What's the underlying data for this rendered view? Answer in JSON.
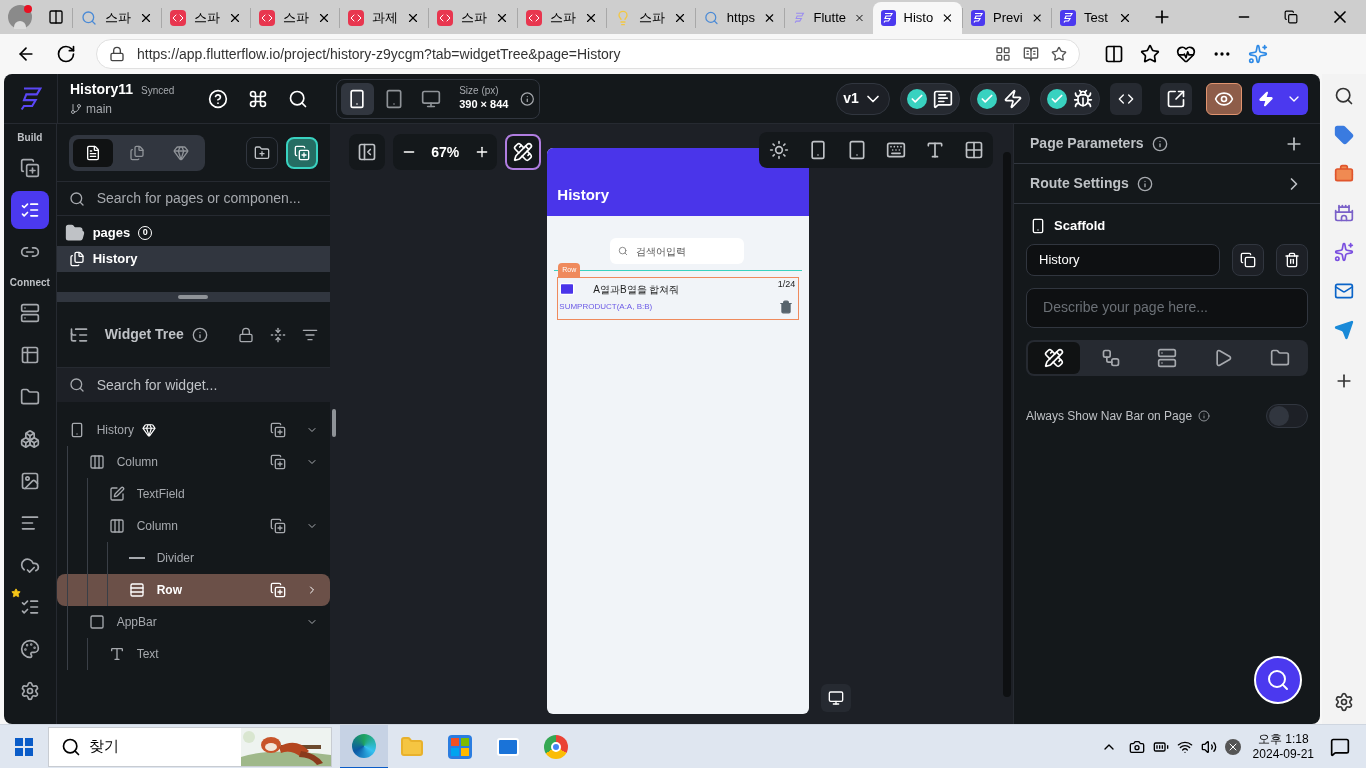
{
  "browser": {
    "tabs": [
      {
        "label": "스파",
        "kind": "search",
        "selected": false
      },
      {
        "label": "스파",
        "kind": "code",
        "selected": false
      },
      {
        "label": "스파",
        "kind": "code",
        "selected": false
      },
      {
        "label": "과제",
        "kind": "code",
        "selected": false
      },
      {
        "label": "스파",
        "kind": "code",
        "selected": false
      },
      {
        "label": "스파",
        "kind": "code",
        "selected": false
      },
      {
        "label": "스파",
        "kind": "bulb",
        "selected": false
      },
      {
        "label": "https",
        "kind": "search",
        "selected": false
      },
      {
        "label": "Flutte",
        "kind": "ff-light",
        "selected": false
      },
      {
        "label": "Histo",
        "kind": "ff",
        "selected": true
      },
      {
        "label": "Previ",
        "kind": "ff",
        "selected": false
      },
      {
        "label": "Test",
        "kind": "ff",
        "selected": false
      }
    ],
    "url": "https://app.flutterflow.io/project/history-z9ycgm?tab=widgetTree&page=History"
  },
  "header": {
    "project": "History11",
    "sync_status": "Synced",
    "branch": "main",
    "devices": [
      {
        "kind": "phone",
        "selected": true
      },
      {
        "kind": "tablet",
        "selected": false
      },
      {
        "kind": "desktop",
        "selected": false
      }
    ],
    "size_label": "Size (px)",
    "size_value": "390 × 844",
    "version": "v1"
  },
  "rail": [
    {
      "label": "Build",
      "items": [
        {
          "selected": false
        },
        {
          "selected": true
        },
        {
          "selected": false
        }
      ]
    },
    {
      "label": "Connect",
      "items": [
        {
          "selected": false
        },
        {
          "selected": false
        },
        {
          "selected": false
        },
        {
          "selected": false
        },
        {
          "selected": false
        },
        {
          "selected": false
        },
        {
          "selected": false
        },
        {
          "selected": false
        },
        {
          "selected": false
        },
        {
          "selected": false
        }
      ]
    }
  ],
  "pages_panel": {
    "tabs": [
      {
        "selected": true
      },
      {
        "selected": false
      },
      {
        "selected": false
      }
    ],
    "search_placeholder": "Search for pages or componen...",
    "folder": "pages",
    "count": "0",
    "pages": [
      {
        "label": "History",
        "selected": true
      }
    ]
  },
  "widget_tree": {
    "title": "Widget Tree",
    "search_placeholder": "Search for widget...",
    "nodes": [
      {
        "label": "History",
        "kind": "page",
        "selected": false,
        "expanded": true,
        "add_button": true,
        "children": [
          {
            "label": "Column",
            "kind": "column",
            "selected": false,
            "expanded": true,
            "add_button": true,
            "children": [
              {
                "label": "TextField",
                "kind": "textfield",
                "selected": false,
                "expanded": false,
                "add_button": false
              },
              {
                "label": "Column",
                "kind": "column",
                "selected": false,
                "expanded": true,
                "add_button": true,
                "children": [
                  {
                    "label": "Divider",
                    "kind": "divider",
                    "selected": false,
                    "expanded": false,
                    "add_button": false
                  },
                  {
                    "label": "Row",
                    "kind": "row",
                    "selected": true,
                    "expanded": false,
                    "add_button": true
                  }
                ]
              }
            ]
          },
          {
            "label": "AppBar",
            "kind": "appbar",
            "selected": false,
            "expanded": true,
            "add_button": false,
            "children": [
              {
                "label": "Text",
                "kind": "text",
                "selected": false,
                "expanded": false,
                "add_button": false
              }
            ]
          }
        ]
      }
    ]
  },
  "canvas": {
    "zoom": "67%",
    "preview": {
      "title": "History",
      "search_placeholder": "검색어입력",
      "selection_tag": "Row",
      "item": {
        "question": "A열과B열을 합쳐줘",
        "count": "1/24",
        "answer": "SUMPRODUCT(A:A, B:B)"
      }
    }
  },
  "properties": {
    "sections": [
      {
        "label": "Page Parameters",
        "kind": "add"
      },
      {
        "label": "Route Settings",
        "kind": "chevron"
      }
    ],
    "widget": "Scaffold",
    "name_value": "History",
    "description_placeholder": "Describe your page here...",
    "tabs": [
      {
        "selected": true
      },
      {
        "selected": false
      },
      {
        "selected": false
      },
      {
        "selected": false
      },
      {
        "selected": false
      }
    ],
    "nav_bar_toggle": {
      "label": "Always Show Nav Bar on Page",
      "on": false
    }
  },
  "taskbar": {
    "search_placeholder": "찾기",
    "apps": [
      {
        "selected": true
      },
      {
        "selected": false
      },
      {
        "selected": false
      },
      {
        "selected": false
      },
      {
        "selected": false
      }
    ],
    "time": "오후 1:18",
    "date": "2024-09-21"
  }
}
